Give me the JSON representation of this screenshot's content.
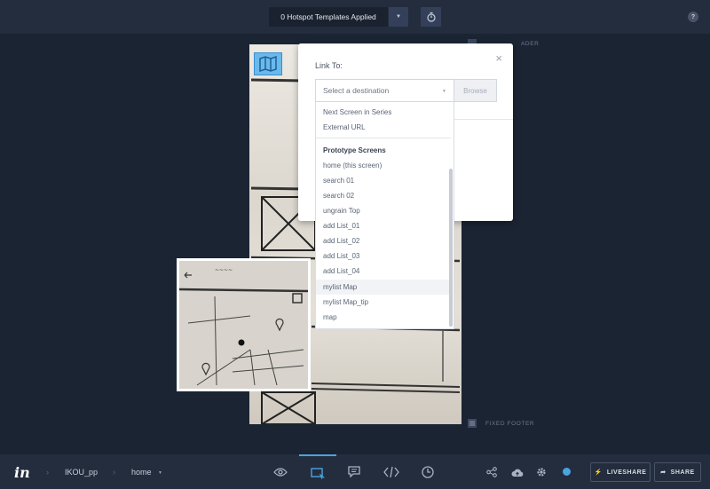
{
  "topbar": {
    "templates_label": "0 Hotspot Templates Applied",
    "help_label": "?"
  },
  "canvas": {
    "header_label": "ADER",
    "footer_label": "FIXED FOOTER"
  },
  "link_panel": {
    "title": "Link To:",
    "close_label": "×",
    "destination_placeholder": "Select a destination",
    "browse_label": "Browse"
  },
  "dropdown": {
    "quick_items": [
      "Next Screen in Series",
      "External URL"
    ],
    "section_header": "Prototype Screens",
    "screens": [
      "home (this screen)",
      "search 01",
      "search 02",
      "ungrain Top",
      "add List_01",
      "add List_02",
      "add List_03",
      "add List_04",
      "mylist Map",
      "mylist Map_tip",
      "map"
    ],
    "hovered_index": 8
  },
  "bottombar": {
    "logo": "in",
    "project": "IKOU_pp",
    "screen": "home",
    "liveshare_label": "LIVESHARE",
    "share_label": "SHARE"
  },
  "colors": {
    "background": "#1b2433",
    "bar": "#232d3d",
    "accent": "#4aa4df",
    "hotspot": "#6ab9ec"
  },
  "icons": {
    "timer": "stopwatch-icon",
    "preview": "eye-icon",
    "build": "hotspot-icon",
    "comment": "comment-icon",
    "inspect": "code-icon",
    "history": "clock-icon",
    "connect": "share-nodes-icon",
    "cloud": "cloud-upload-icon",
    "settings": "gear-icon"
  }
}
